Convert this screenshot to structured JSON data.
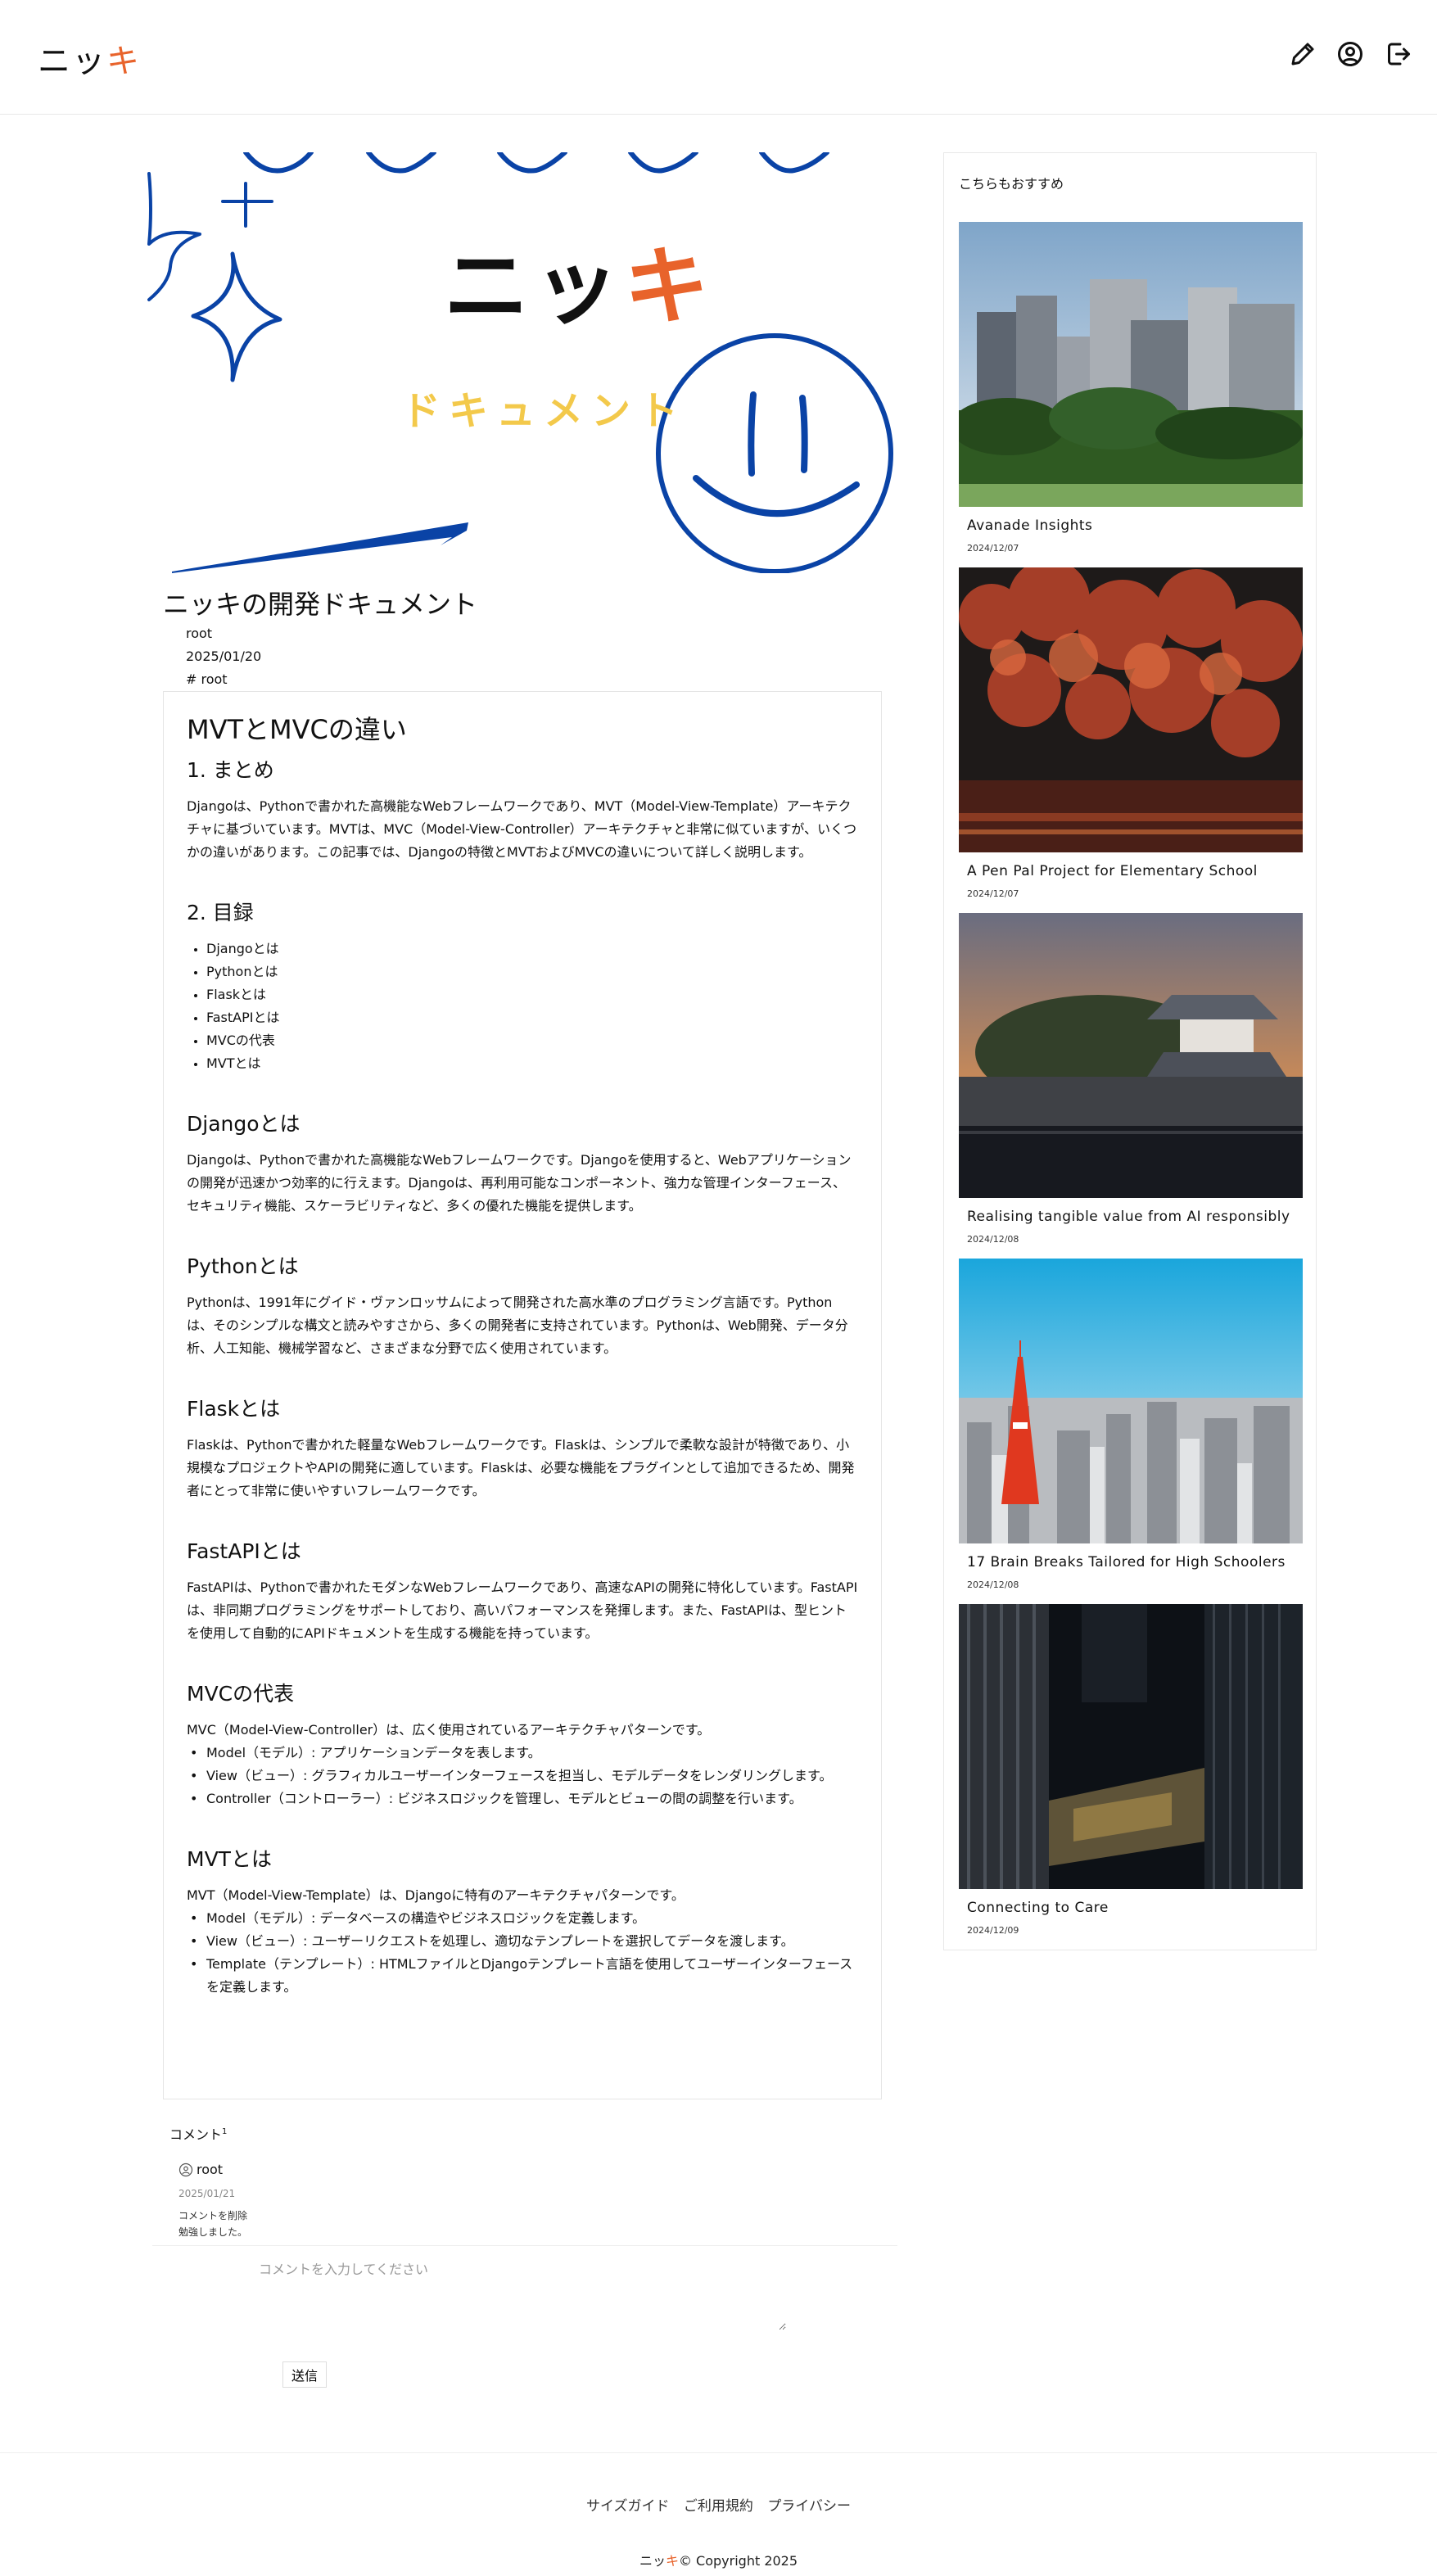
{
  "header": {
    "logo_main": "ニッ",
    "logo_accent": "キ",
    "icons": [
      "pencil-icon",
      "user-circle-icon",
      "logout-icon"
    ]
  },
  "hero": {
    "title_main": "ニッ",
    "title_accent": "キ",
    "subtitle": "ドキュメント"
  },
  "article": {
    "title": "ニッキの開発ドキュメント",
    "author": "root",
    "date": "2025/01/20",
    "tag": "# root",
    "heading": "MVTとMVCの違い",
    "sections": [
      {
        "title": "1. まとめ",
        "text": "Djangoは、Pythonで書かれた高機能なWebフレームワークであり、MVT（Model-View-Template）アーキテクチャに基づいています。MVTは、MVC（Model-View-Controller）アーキテクチャと非常に似ていますが、いくつかの違いがあります。この記事では、Djangoの特徴とMVTおよびMVCの違いについて詳しく説明します。"
      },
      {
        "title": "2. 目録",
        "items": [
          "Djangoとは",
          "Pythonとは",
          "Flaskとは",
          "FastAPIとは",
          "MVCの代表",
          "MVTとは"
        ]
      },
      {
        "title": "Djangoとは",
        "text": "Djangoは、Pythonで書かれた高機能なWebフレームワークです。Djangoを使用すると、Webアプリケーションの開発が迅速かつ効率的に行えます。Djangoは、再利用可能なコンポーネント、強力な管理インターフェース、セキュリティ機能、スケーラビリティなど、多くの優れた機能を提供します。"
      },
      {
        "title": "Pythonとは",
        "text": "Pythonは、1991年にグイド・ヴァンロッサムによって開発された高水準のプログラミング言語です。Pythonは、そのシンプルな構文と読みやすさから、多くの開発者に支持されています。Pythonは、Web開発、データ分析、人工知能、機械学習など、さまざまな分野で広く使用されています。"
      },
      {
        "title": "Flaskとは",
        "text": "Flaskは、Pythonで書かれた軽量なWebフレームワークです。Flaskは、シンプルで柔軟な設計が特徴であり、小規模なプロジェクトやAPIの開発に適しています。Flaskは、必要な機能をプラグインとして追加できるため、開発者にとって非常に使いやすいフレームワークです。"
      },
      {
        "title": "FastAPIとは",
        "text": "FastAPIは、Pythonで書かれたモダンなWebフレームワークであり、高速なAPIの開発に特化しています。FastAPIは、非同期プログラミングをサポートしており、高いパフォーマンスを発揮します。また、FastAPIは、型ヒントを使用して自動的にAPIドキュメントを生成する機能を持っています。"
      },
      {
        "title": "MVCの代表",
        "intro": "MVC（Model-View-Controller）は、広く使用されているアーキテクチャパターンです。",
        "rows": [
          "Model（モデル）: アプリケーションデータを表します。",
          "View（ビュー）: グラフィカルユーザーインターフェースを担当し、モデルデータをレンダリングします。",
          "Controller（コントローラー）: ビジネスロジックを管理し、モデルとビューの間の調整を行います。"
        ]
      },
      {
        "title": "MVTとは",
        "intro": "MVT（Model-View-Template）は、Djangoに特有のアーキテクチャパターンです。",
        "rows": [
          "Model（モデル）: データベースの構造やビジネスロジックを定義します。",
          "View（ビュー）: ユーザーリクエストを処理し、適切なテンプレートを選択してデータを渡します。",
          "Template（テンプレート）: HTMLファイルとDjangoテンプレート言語を使用してユーザーインターフェースを定義します。"
        ]
      }
    ]
  },
  "comments": {
    "heading": "コメント",
    "count": "1",
    "items": [
      {
        "user": "root",
        "date": "2025/01/21",
        "delete_label": "コメントを削除",
        "text": "勉強しました。"
      }
    ],
    "input_placeholder": "コメントを入力してください",
    "submit_label": "送信"
  },
  "sidebar": {
    "title": "こちらもおすすめ",
    "items": [
      {
        "title": "Avanade Insights",
        "date": "2024/12/07",
        "image": "city-skyline-park-photo"
      },
      {
        "title": "A Pen Pal Project for Elementary School",
        "date": "2024/12/07",
        "image": "autumn-maple-temple-photo"
      },
      {
        "title": "Realising tangible value from AI responsibly",
        "date": "2024/12/08",
        "image": "castle-moat-sunset-photo"
      },
      {
        "title": "17 Brain Breaks Tailored for High Schoolers",
        "date": "2024/12/08",
        "image": "tokyo-tower-cityscape-photo"
      },
      {
        "title": "Connecting to Care",
        "date": "2024/12/09",
        "image": "dark-skyscrapers-photo"
      }
    ]
  },
  "footer": {
    "links": [
      "サイズガイド",
      "ご利用規約",
      "プライバシー"
    ],
    "copyright_main": "ニッ",
    "copyright_accent": "キ",
    "copyright_rest": "© Copyright 2025"
  },
  "colors": {
    "accent": "#e8632b",
    "hero_blue": "#0a43a6",
    "hero_yellow": "#f3c94b"
  }
}
